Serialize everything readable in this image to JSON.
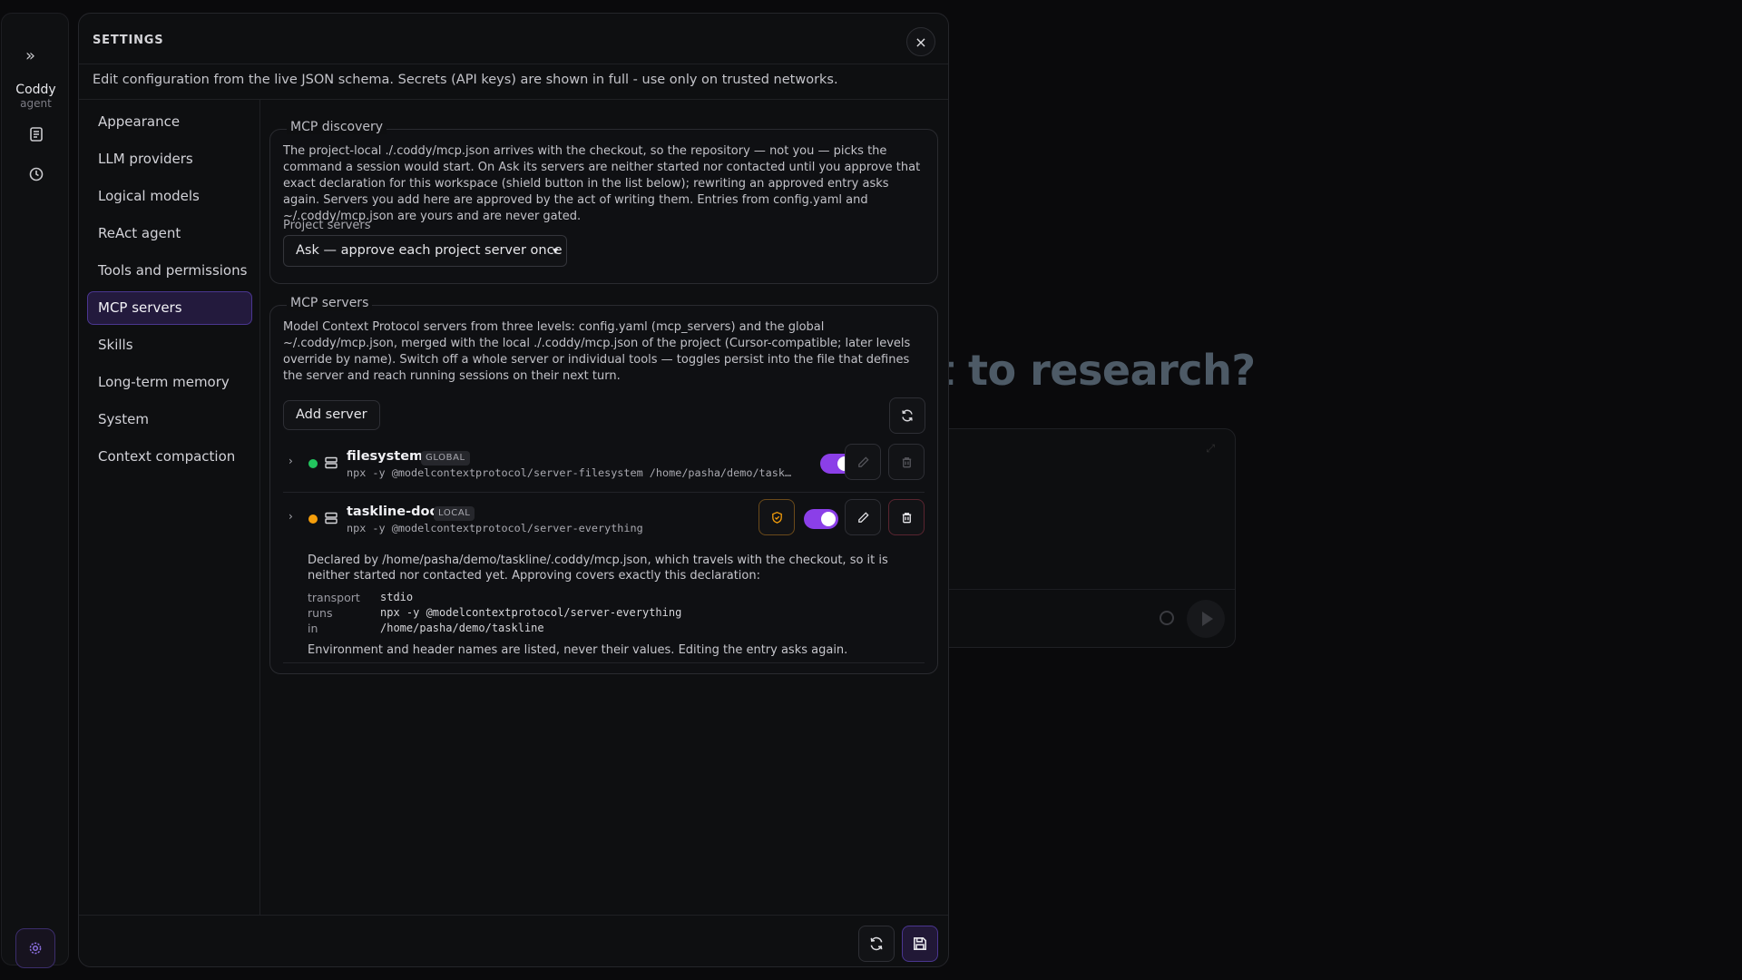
{
  "background": {
    "heading": "t to research?"
  },
  "rail": {
    "brand": "Coddy",
    "brand_sub": "agent"
  },
  "modal": {
    "title": "SETTINGS",
    "subtitle": "Edit configuration from the live JSON schema. Secrets (API keys) are shown in full - use only on trusted networks.",
    "close_label": "×"
  },
  "nav": {
    "items": [
      {
        "label": "Appearance"
      },
      {
        "label": "LLM providers"
      },
      {
        "label": "Logical models"
      },
      {
        "label": "ReAct agent"
      },
      {
        "label": "Tools and permissions"
      },
      {
        "label": "MCP servers",
        "active": true
      },
      {
        "label": "Skills"
      },
      {
        "label": "Long-term memory"
      },
      {
        "label": "System"
      },
      {
        "label": "Context compaction"
      }
    ]
  },
  "discovery": {
    "legend": "MCP discovery",
    "description": "The project-local ./.coddy/mcp.json arrives with the checkout, so the repository — not you — picks the command a session would start. On Ask its servers are neither started nor contacted until you approve that exact declaration for this workspace (shield button in the list below); rewriting an approved entry asks again. Servers you add here are approved by the act of writing them. Entries from config.yaml and ~/.coddy/mcp.json are yours and are never gated.",
    "field_label": "Project servers",
    "selected": "Ask — approve each project server once"
  },
  "servers": {
    "legend": "MCP servers",
    "description": "Model Context Protocol servers from three levels: config.yaml (mcp_servers) and the global ~/.coddy/mcp.json, merged with the local ./.coddy/mcp.json of the project (Cursor-compatible; later levels override by name). Switch off a whole server or individual tools — toggles persist into the file that defines the server and reach running sessions on their next turn.",
    "add_label": "Add server",
    "list": [
      {
        "name": "filesystem",
        "badge": "GLOBAL",
        "command": "npx -y @modelcontextprotocol/server-filesystem /home/pasha/demo/taskline",
        "status_color": "#22c55e",
        "enabled": true
      },
      {
        "name": "taskline-docs",
        "badge": "LOCAL",
        "command": "npx -y @modelcontextprotocol/server-everything",
        "status_color": "#f59e0b",
        "enabled": true,
        "detail": {
          "text": "Declared by /home/pasha/demo/taskline/.coddy/mcp.json, which travels with the checkout, so it is neither started nor contacted yet. Approving covers exactly this declaration:",
          "rows": [
            {
              "key": "transport",
              "value": "stdio"
            },
            {
              "key": "runs",
              "value": "npx -y @modelcontextprotocol/server-everything"
            },
            {
              "key": "in",
              "value": "/home/pasha/demo/taskline"
            }
          ],
          "footnote": "Environment and header names are listed, never their values. Editing the entry asks again."
        }
      }
    ]
  },
  "colors": {
    "accent": "#8b3fe8",
    "active_nav": "#231a3d",
    "danger": "#e05566",
    "warn": "#f59e0b"
  }
}
